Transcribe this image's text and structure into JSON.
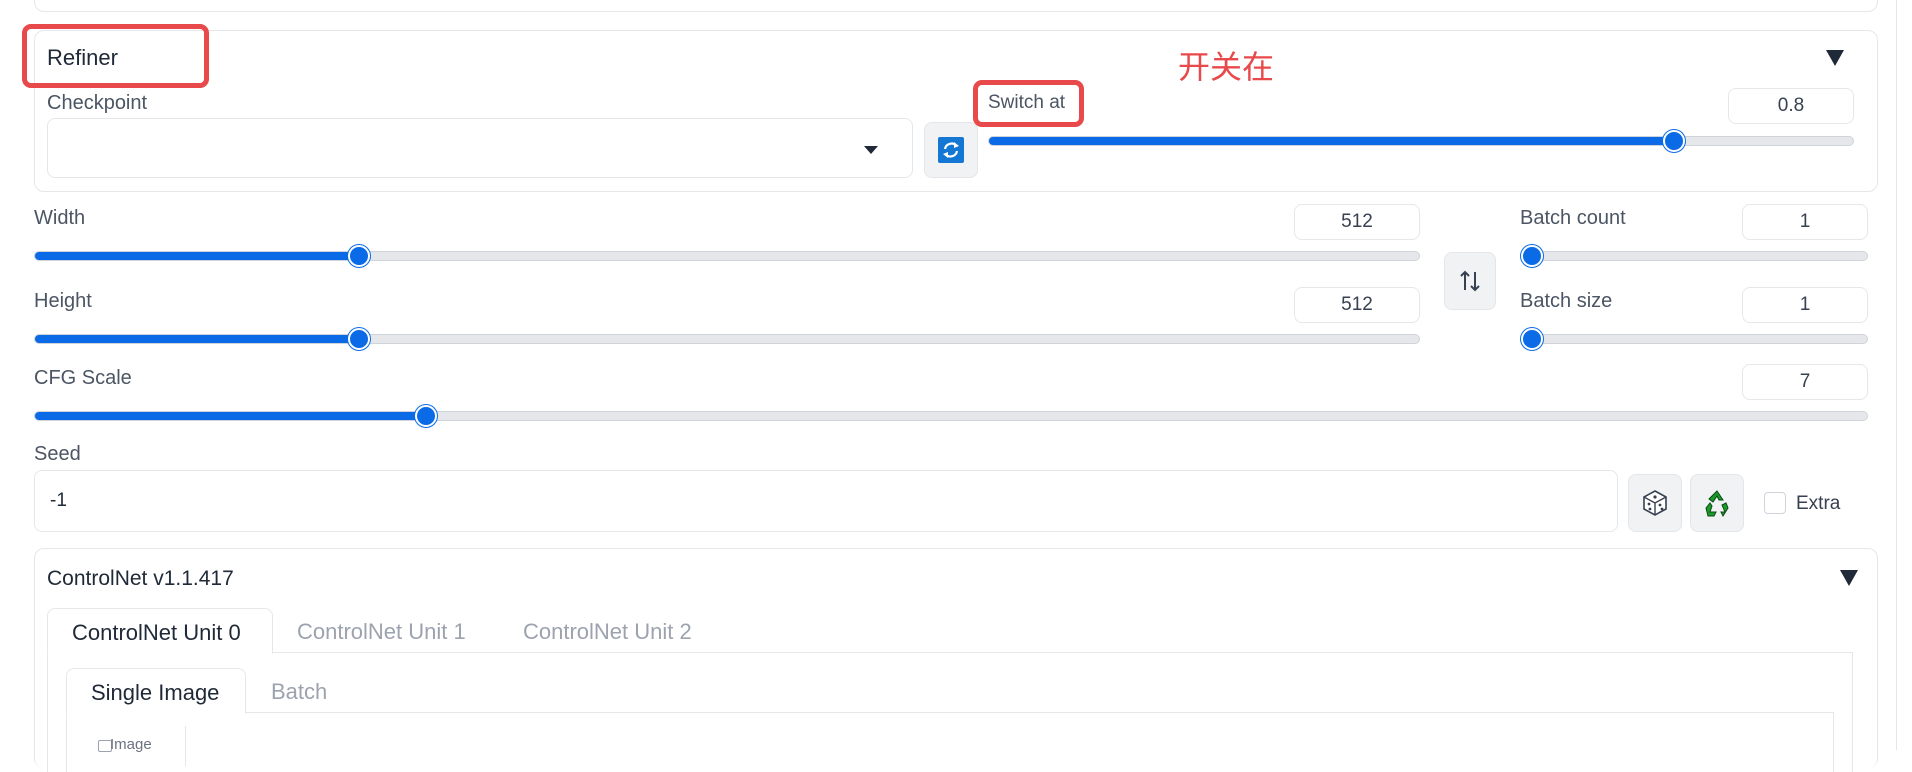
{
  "annotation": {
    "text": "开关在",
    "color": "#e8494a"
  },
  "refiner": {
    "title": "Refiner",
    "collapse_icon": "triangle-down-icon",
    "checkpoint": {
      "label": "Checkpoint",
      "value": ""
    },
    "refresh_icon": "refresh-icon",
    "switch_at": {
      "label": "Switch at",
      "value": "0.8",
      "fraction": 0.8
    }
  },
  "dimensions": {
    "width": {
      "label": "Width",
      "value": "512",
      "fraction": 0.23
    },
    "height": {
      "label": "Height",
      "value": "512",
      "fraction": 0.23
    },
    "swap_icon": "swap-vertical-icon",
    "batch_count": {
      "label": "Batch count",
      "value": "1",
      "fraction": 0.0
    },
    "batch_size": {
      "label": "Batch size",
      "value": "1",
      "fraction": 0.0
    }
  },
  "cfg": {
    "label": "CFG Scale",
    "value": "7",
    "fraction": 0.21
  },
  "seed": {
    "label": "Seed",
    "value": "-1",
    "dice_icon": "dice-icon",
    "recycle_icon": "recycle-icon",
    "extra_label": "Extra"
  },
  "controlnet": {
    "title": "ControlNet v1.1.417",
    "tabs": [
      "ControlNet Unit 0",
      "ControlNet Unit 1",
      "ControlNet Unit 2"
    ],
    "subtabs": [
      "Single Image",
      "Batch"
    ],
    "image_label": "Image"
  },
  "colors": {
    "accent": "#0b6be6",
    "highlight": "#e8494a"
  }
}
